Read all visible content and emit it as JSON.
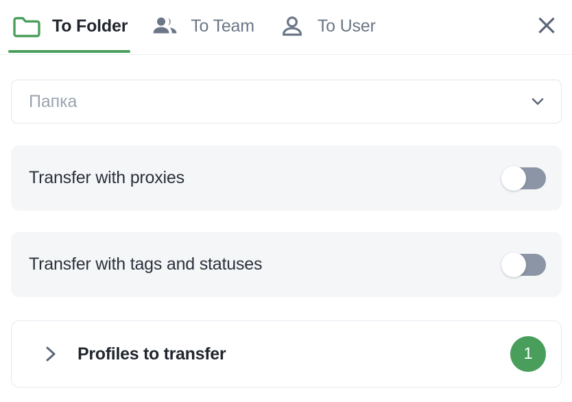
{
  "colors": {
    "accent_green": "#4a9e5c",
    "toggle_off_track": "#8b95a5",
    "row_background": "#f4f6f8",
    "text_primary": "#21262e",
    "text_muted": "#6b7687",
    "placeholder": "#9aa3b0",
    "border": "#e2e6eb"
  },
  "header": {
    "tabs": [
      {
        "label": "To Folder",
        "icon": "folder-icon",
        "active": true
      },
      {
        "label": "To Team",
        "icon": "users-icon",
        "active": false
      },
      {
        "label": "To User",
        "icon": "user-icon",
        "active": false
      }
    ],
    "close_icon": "close-icon"
  },
  "folder_select": {
    "placeholder": "Папка",
    "value": "",
    "chevron_icon": "chevron-down-icon"
  },
  "options": [
    {
      "label": "Transfer with proxies",
      "enabled": false
    },
    {
      "label": "Transfer with tags and statuses",
      "enabled": false
    }
  ],
  "profiles_section": {
    "title": "Profiles to transfer",
    "count": "1",
    "expand_icon": "chevron-right-icon",
    "expanded": false
  }
}
